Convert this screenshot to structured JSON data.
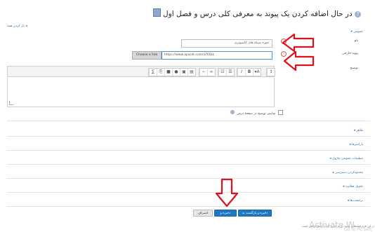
{
  "page": {
    "title": "در حال اضافه کردن یک پیوند به معرفی کلی درس و فصل اول",
    "expand_all": "باز کردن همه"
  },
  "general": {
    "section_label": "عمومی",
    "name_label": "نام",
    "name_value": "حوزه شبکه های کامپیوتری",
    "url_label": "پیوند خارجی",
    "choose_link": "Choose a link",
    "url_value": "https://www.aparat.com/v/XXkk",
    "description_label": "توضیح",
    "show_description": "نمایش توضیح در صفحهٔ درس"
  },
  "toolbar": {
    "group1": [
      "𝔐",
      "⎘",
      "▣",
      "🎙",
      "▤",
      "▦"
    ],
    "group2": [
      "⛓",
      "⛓"
    ],
    "group3": [
      "☷",
      "☰"
    ],
    "group4": [
      "I",
      "B",
      "▾A",
      "i"
    ]
  },
  "sections": [
    "ظاهر",
    "پارامترها",
    "تنظیمات عمومی ماژول",
    "محدودکردن دسترسی",
    "تکمیل فعالیت",
    "برچسب‌ها"
  ],
  "buttons": {
    "save_return": "ذخیره و بازگشت به درس",
    "save_display": "ذخیره و نمایش",
    "cancel": "انصراف"
  },
  "footer_note": "در این فرم فیلدهایی وجود دارند که پر کردن آن‌ها الزامی است",
  "watermark": "Activate W",
  "watermark2": "Go to PC sett"
}
